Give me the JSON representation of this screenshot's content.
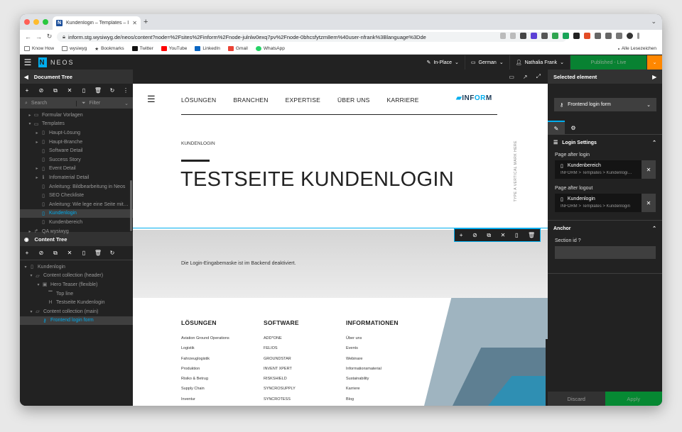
{
  "browser": {
    "tab_title": "Kundenlogin – Templates – Info…",
    "url": "inform.stg.wysiwyg.de/neos/content?node=%2Fsites%2Finform%2Fnode-julnlw0exq7pv%2Fnode-0bhcsfytzm8em%40user-nfrank%3Blanguage%3Dde",
    "bookmarks": [
      "Know How",
      "wysiwyg",
      "Bookmarks",
      "Twitter",
      "YouTube",
      "LinkedIn",
      "Gmail",
      "WhatsApp"
    ],
    "bookmarks_right": "Alle Lesezeichen"
  },
  "neos": {
    "logo": "NEOS",
    "edit_mode": "In-Place",
    "language": "German",
    "user": "Nathalia Frank",
    "publish_label": "Published - Live"
  },
  "document_tree": {
    "title": "Document Tree",
    "search_placeholder": "Search",
    "filter_placeholder": "Filter",
    "items": [
      {
        "label": "Formular Vorlagen",
        "icon": "folder-icon"
      },
      {
        "label": "Templates",
        "icon": "folder-icon"
      },
      {
        "label": "Haupt-Lösung",
        "icon": "page-icon"
      },
      {
        "label": "Haupt-Branche",
        "icon": "page-icon"
      },
      {
        "label": "Software Detail",
        "icon": "page-icon"
      },
      {
        "label": "Success Story",
        "icon": "page-icon"
      },
      {
        "label": "Event Detail",
        "icon": "page-icon"
      },
      {
        "label": "Infomaterial Detail",
        "icon": "info-icon"
      },
      {
        "label": "Anleitung: Bildbearbeitung in Neos",
        "icon": "page-icon"
      },
      {
        "label": "SEO Checkliste",
        "icon": "page-icon"
      },
      {
        "label": "Anleitung: Wie lege eine Seite mit…",
        "icon": "page-icon"
      },
      {
        "label": "Kundenlogin",
        "icon": "page-icon"
      },
      {
        "label": "Kundenbereich",
        "icon": "page-icon"
      },
      {
        "label": "QA wysiwyg",
        "icon": "link-icon"
      }
    ]
  },
  "content_tree": {
    "title": "Content Tree",
    "items": [
      {
        "label": "Kundenlogin"
      },
      {
        "label": "Content collection (header)"
      },
      {
        "label": "Hero Teaser (flexible)"
      },
      {
        "label": "Top line"
      },
      {
        "label": "Testseite Kundenlogin"
      },
      {
        "label": "Content collection (main)"
      },
      {
        "label": "Frontend login form"
      }
    ]
  },
  "site": {
    "menu": [
      "LÖSUNGEN",
      "BRANCHEN",
      "EXPERTISE",
      "ÜBER UNS",
      "KARRIERE"
    ],
    "logo_a": "INF",
    "logo_b": "OR",
    "logo_c": "M",
    "kicker": "KUNDENLOGIN",
    "headline": "TESTSEITE KUNDENLOGIN",
    "vertical": "TYPE A VERTICAL MARK HERE",
    "login_notice": "Die Login-Eingabemaske ist im Backend deaktiviert.",
    "footer": [
      {
        "title": "LÖSUNGEN",
        "items": [
          "Aviation Ground Operations",
          "Logistik",
          "Fahrzeuglogistik",
          "Produktion",
          "Risiko & Betrug",
          "Supply Chain",
          "Inventur"
        ]
      },
      {
        "title": "SOFTWARE",
        "items": [
          "ADD*ONE",
          "FELIOS",
          "GROUNDSTAR",
          "INVENT XPERT",
          "RISKSHIELD",
          "SYNCROSUPPLY",
          "SYNCROTESS"
        ]
      },
      {
        "title": "INFORMATIONEN",
        "items": [
          "Über uns",
          "Events",
          "Webinare",
          "Informationsmaterial",
          "Sustainability",
          "Karriere",
          "Blog"
        ]
      }
    ]
  },
  "inspector": {
    "title": "Selected element",
    "selected": "Frontend login form",
    "section_login": "Login Settings",
    "page_after_login_label": "Page after login",
    "page_after_login_name": "Kundenbereich",
    "page_after_login_path": "INFORM > Templates > Kundenlogi…",
    "page_after_logout_label": "Page after logout",
    "page_after_logout_name": "Kundenlogin",
    "page_after_logout_path": "INFORM > Templates > Kundenlogin",
    "section_anchor": "Anchor",
    "section_id_label": "Section id",
    "discard": "Discard",
    "apply": "Apply"
  },
  "colors": {
    "neos_blue": "#00adee",
    "published_green": "#00a338",
    "orange": "#ff8700"
  }
}
